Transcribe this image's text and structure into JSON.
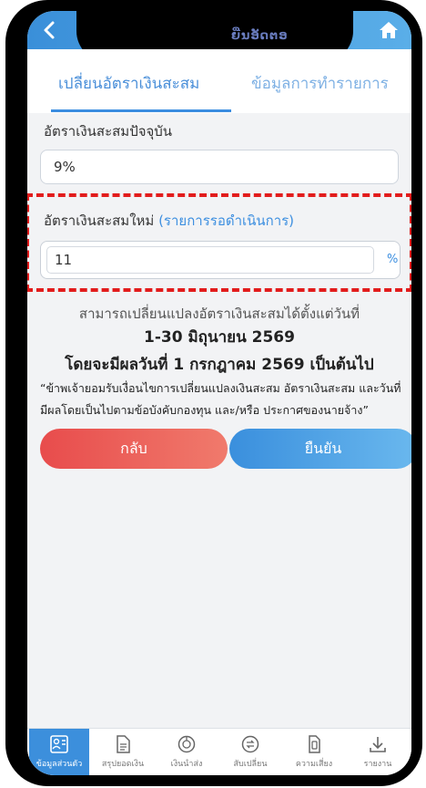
{
  "header": {
    "title": "ຍີ່ນອັດຕອ"
  },
  "tabs": [
    {
      "label": "เปลี่ยนอัตราเงินสะสม"
    },
    {
      "label": "ข้อมูลการทำรายการ"
    }
  ],
  "current_rate": {
    "label": "อัตราเงินสะสมปัจจุบัน",
    "value": "9%"
  },
  "new_rate": {
    "label": "อัตราเงินสะสมใหม่",
    "pending": "(รายการรอดำเนินการ)",
    "value": "11",
    "unit": "%"
  },
  "info": {
    "line1": "สามารถเปลี่ยนแปลงอัตราเงินสะสมได้ตั้งแต่วันที่",
    "line2": "1-30 มิถุนายน 2569",
    "line3": "โดยจะมีผลวันที่ 1 กรกฎาคม 2569 เป็นต้นไป",
    "note": "“ข้าพเจ้ายอมรับเงื่อนไขการเปลี่ยนแปลงเงินสะสม อัตราเงินสะสม และวันที่มีผลโดยเป็นไปตามข้อบังคับกองทุน และ/หรือ ประกาศของนายจ้าง”"
  },
  "buttons": {
    "back": "กลับ",
    "confirm": "ยืนยัน"
  },
  "bottom_nav": [
    {
      "label": "ข้อมูลส่วนตัว",
      "icon": "profile-icon",
      "active": true
    },
    {
      "label": "สรุปยอดเงิน",
      "icon": "document-icon"
    },
    {
      "label": "เงินนำส่ง",
      "icon": "pie-chart-icon"
    },
    {
      "label": "สับเปลี่ยน",
      "icon": "switch-icon"
    },
    {
      "label": "ความเสี่ยง",
      "icon": "clipboard-icon"
    },
    {
      "label": "รายงาน",
      "icon": "download-icon"
    }
  ],
  "colors": {
    "primary": "#3b8de0",
    "back_button": "#e84c4c",
    "highlight_border": "#e21c1c"
  }
}
